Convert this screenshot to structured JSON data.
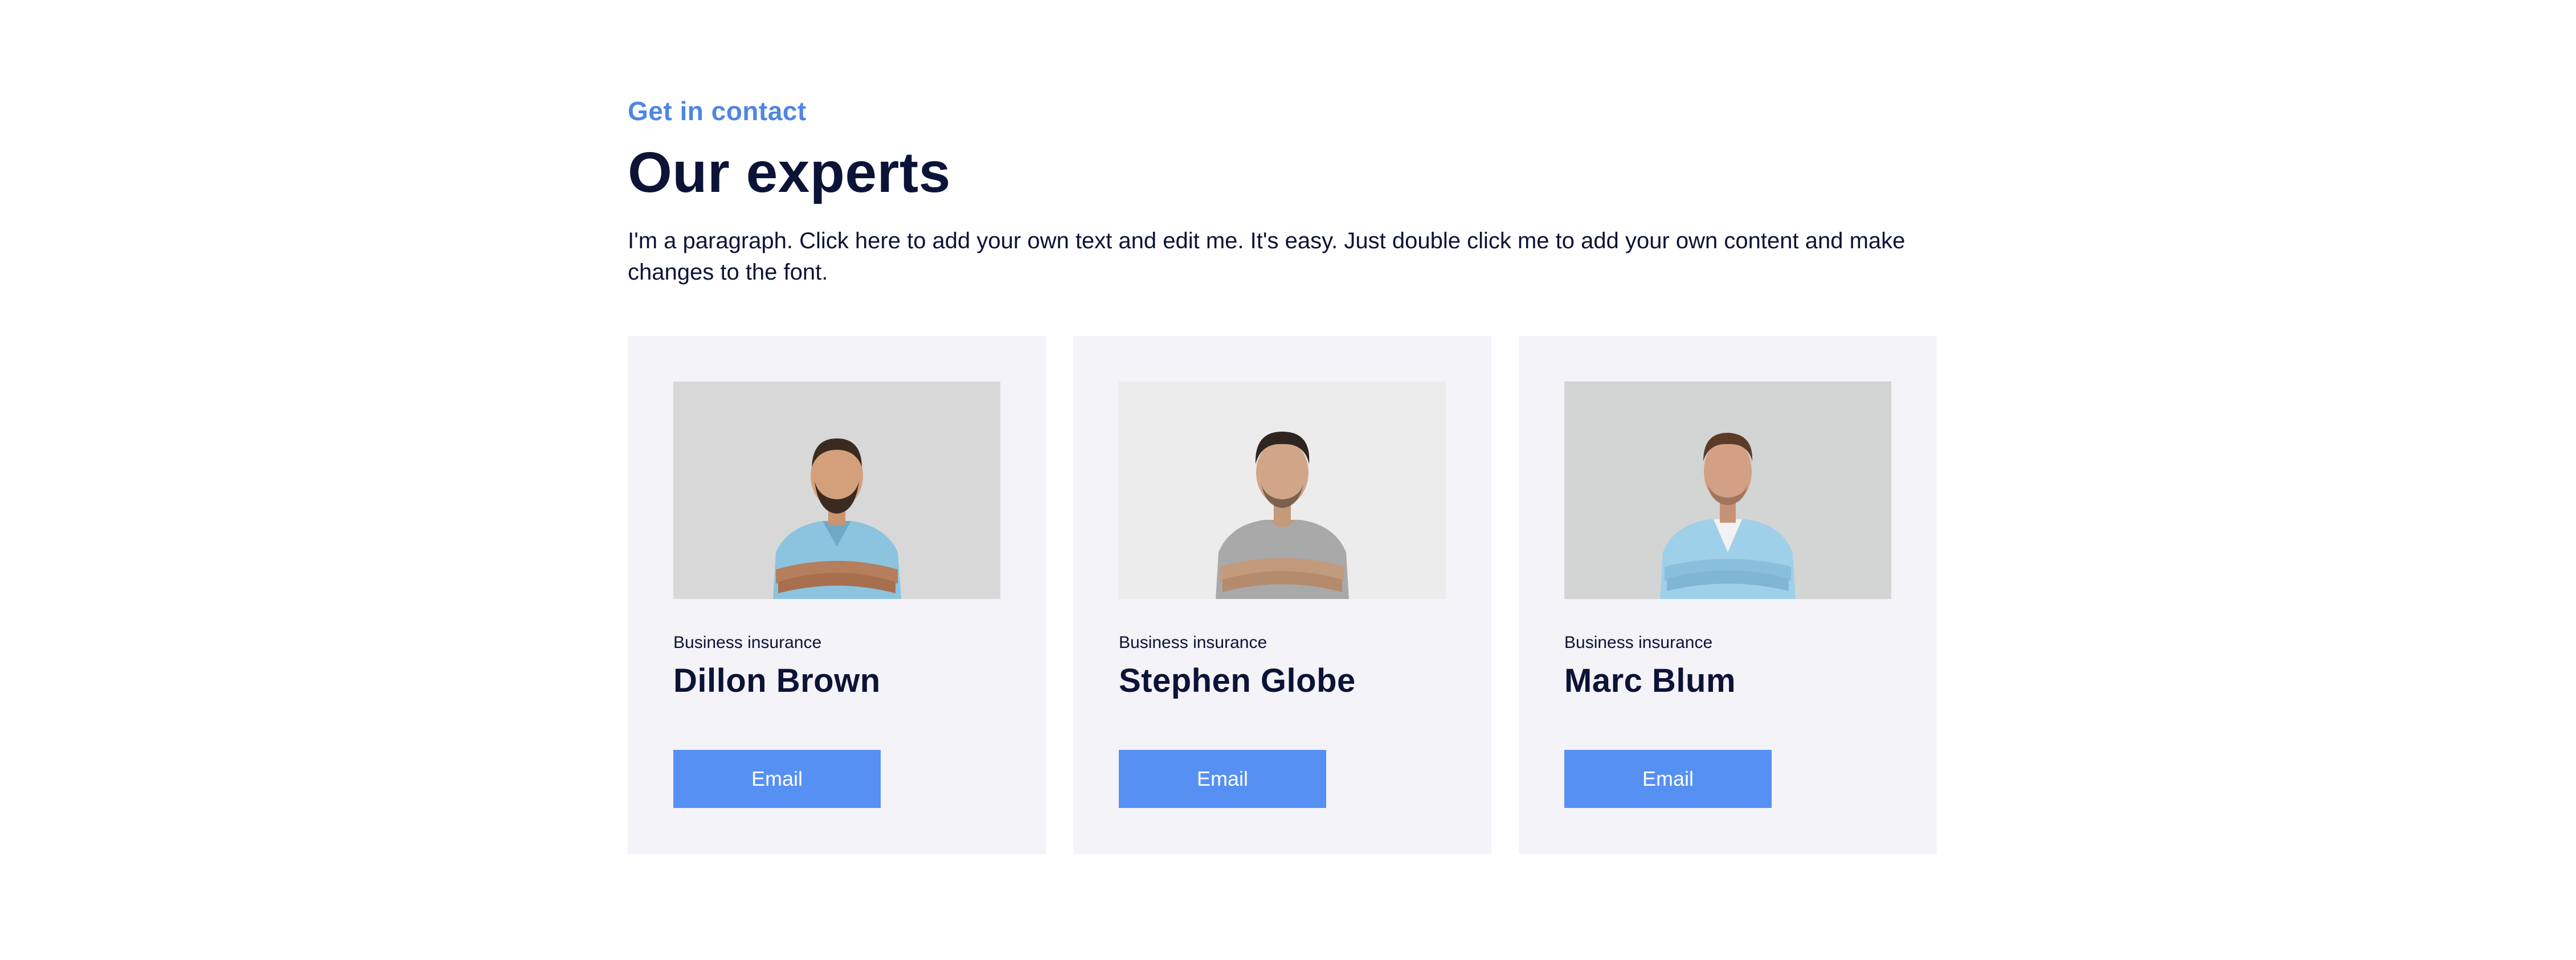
{
  "header": {
    "kicker": "Get in contact",
    "title": "Our experts",
    "paragraph": "I'm a paragraph. Click here to add your own text and edit me. It's easy. Just double click me to add your own content and make changes to the font."
  },
  "experts": [
    {
      "role": "Business insurance",
      "name": "Dillon Brown",
      "button": "Email",
      "photo_bg": "#d8d8d8",
      "shirt": "#8cc4e0"
    },
    {
      "role": "Business insurance",
      "name": "Stephen Globe",
      "button": "Email",
      "photo_bg": "#ececec",
      "shirt": "#a9a9a9"
    },
    {
      "role": "Business insurance",
      "name": "Marc Blum",
      "button": "Email",
      "photo_bg": "#d3d5d4",
      "shirt": "#9fd0ea"
    }
  ],
  "colors": {
    "accent": "#5690f2",
    "kicker": "#4f86e3",
    "heading": "#0b1337",
    "card_bg": "#f4f3f8"
  }
}
